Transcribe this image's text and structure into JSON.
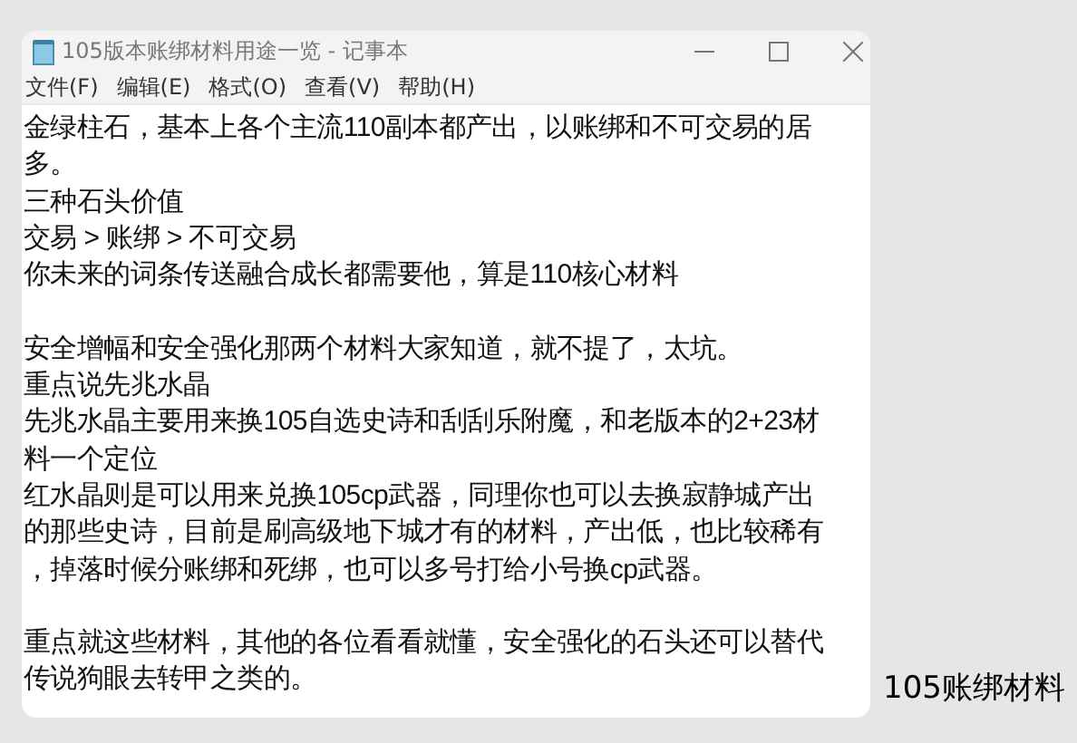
{
  "window": {
    "title": "105版本账绑材料用途一览 - 记事本"
  },
  "menu": [
    "文件(F)",
    "编辑(E)",
    "格式(O)",
    "查看(V)",
    "帮助(H)"
  ],
  "lines": [
    {
      "text": "金绿柱石，基本上各个主流110副本都产出，以账绑和不可交易的居",
      "space_before": false
    },
    {
      "text": "多。",
      "space_before": false
    },
    {
      "text": "三种石头价值",
      "space_before": false
    },
    {
      "text": "交易 > 账绑 > 不可交易",
      "space_before": false
    },
    {
      "text": "你未来的词条传送融合成长都需要他，算是110核心材料",
      "space_before": false
    },
    {
      "text": "安全增幅和安全强化那两个材料大家知道，就不提了，太坑。",
      "space_before": true
    },
    {
      "text": "重点说先兆水晶",
      "space_before": false
    },
    {
      "text": "先兆水晶主要用来换105自选史诗和刮刮乐附魔，和老版本的2+23材",
      "space_before": false
    },
    {
      "text": "料一个定位",
      "space_before": false
    },
    {
      "text": "红水晶则是可以用来兑换105cp武器，同理你也可以去换寂静城产出",
      "space_before": false
    },
    {
      "text": "的那些史诗，目前是刷高级地下城才有的材料，产出低，也比较稀有",
      "space_before": false
    },
    {
      "text": "，掉落时候分账绑和死绑，也可以多号打给小号换cp武器。",
      "space_before": false
    },
    {
      "text": "重点就这些材料，其他的各位看看就懂，安全强化的石头还可以替代",
      "space_before": true
    },
    {
      "text": "传说狗眼去转甲之类的。",
      "space_before": false
    }
  ],
  "caption": "105账绑材料"
}
